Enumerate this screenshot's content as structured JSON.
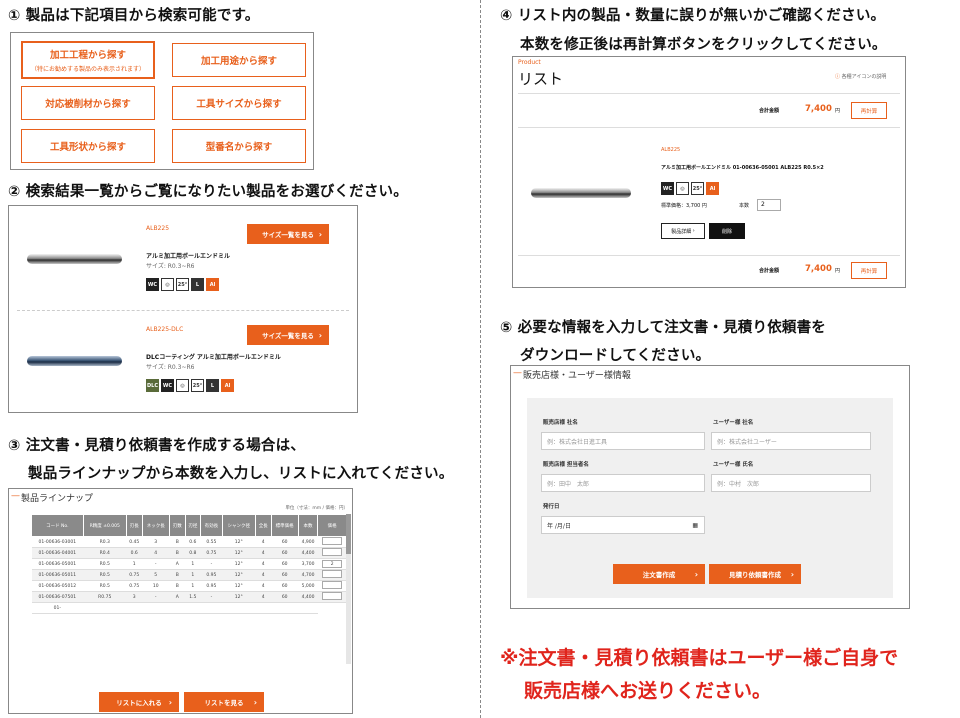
{
  "step1": {
    "title": "① 製品は下記項目から検索可能です。",
    "buttons": [
      "加工工程から探す",
      "加工用途から探す",
      "対応被削材から探す",
      "工具サイズから探す",
      "工具形状から探す",
      "型番名から探す"
    ],
    "button0_sub": "（特にお勧めする製品のみ表示されます）"
  },
  "step2": {
    "title": "② 検索結果一覧からご覧になりたい製品をお選びください。",
    "items": [
      {
        "code": "ALB225",
        "name": "アルミ加工用ボールエンドミル",
        "size": "サイズ: R0.3~R6",
        "button": "サイズ一覧を見る"
      },
      {
        "code": "ALB225-DLC",
        "name": "DLCコーティング アルミ加工用ボールエンドミル",
        "size": "サイズ: R0.3~R6",
        "button": "サイズ一覧を見る"
      }
    ]
  },
  "step3": {
    "title_line1": "③ 注文書・見積り依頼書を作成する場合は、",
    "title_line2": "製品ラインナップから本数を入力し、リストに入れてください。",
    "panel_title": "製品ラインナップ",
    "unit_note": "単位（寸法：mm / 価格：円）",
    "headers": [
      "コード No.",
      "R精度 ±0.005",
      "刃長",
      "ネック長",
      "刃数",
      "刃径",
      "有効長",
      "シャンク径",
      "全長",
      "標準価格",
      "本数",
      "価格"
    ],
    "rows": [
      [
        "01-00636-03001",
        "R0.3",
        "0.45",
        "3",
        "B",
        "0.6",
        "0.55",
        "12°",
        "4",
        "60",
        "4,900",
        ""
      ],
      [
        "01-00636-04001",
        "R0.4",
        "0.6",
        "4",
        "B",
        "0.8",
        "0.75",
        "12°",
        "4",
        "60",
        "4,400",
        ""
      ],
      [
        "01-00636-05001",
        "R0.5",
        "1",
        "-",
        "A",
        "1",
        "-",
        "12°",
        "4",
        "60",
        "3,700",
        "2"
      ],
      [
        "01-00636-05011",
        "R0.5",
        "0.75",
        "5",
        "B",
        "1",
        "0.95",
        "12°",
        "4",
        "60",
        "4,700",
        ""
      ],
      [
        "01-00636-05012",
        "R0.5",
        "0.75",
        "10",
        "B",
        "1",
        "0.95",
        "12°",
        "4",
        "60",
        "5,000",
        ""
      ],
      [
        "01-00636-07501",
        "R0.75",
        "3",
        "-",
        "A",
        "1.5",
        "-",
        "12°",
        "4",
        "60",
        "4,400",
        ""
      ],
      [
        "01-",
        "",
        "",
        "",
        "",
        "",
        "",
        "",
        "",
        "",
        "",
        ""
      ]
    ],
    "btn_add": "リストに入れる",
    "btn_view": "リストを見る"
  },
  "step4": {
    "title_line1": "④ リスト内の製品・数量に誤りが無いかご確認ください。",
    "title_line2": "本数を修正後は再計算ボタンをクリックしてください。",
    "product_label": "Product",
    "list_title": "リスト",
    "icon_help": "各種アイコンの説明",
    "total_label": "合計金額",
    "total_value": "7,400",
    "yen": "円",
    "recalc": "再計算",
    "item_code": "ALB225",
    "item_name": "アルミ加工用ボールエンドミル 01-00636-05001 ALB225 R0.5×2",
    "price_label": "標準価格：3,700",
    "price_unit": "円",
    "qty_label": "本数",
    "qty_value": "2",
    "detail_btn": "製品詳細",
    "delete_btn": "削除"
  },
  "step5": {
    "title_line1": "⑤ 必要な情報を入力して注文書・見積り依頼書を",
    "title_line2": "ダウンロードしてください。",
    "panel_title": "販売店様・ユーザー様情報",
    "labels": [
      "販売店様 社名",
      "ユーザー様 社名",
      "販売店様 担当者名",
      "ユーザー様 氏名",
      "発行日"
    ],
    "placeholders": [
      "例：株式会社日進工具",
      "例：株式会社ユーザー",
      "例：田中　太郎",
      "例：中村　次郎",
      "年 /月/日"
    ],
    "btn_order": "注文書作成",
    "btn_quote": "見積り依頼書作成"
  },
  "note_line1": "※注文書・見積り依頼書はユーザー様ご自身で",
  "note_line2": "販売店様へお送りください。"
}
